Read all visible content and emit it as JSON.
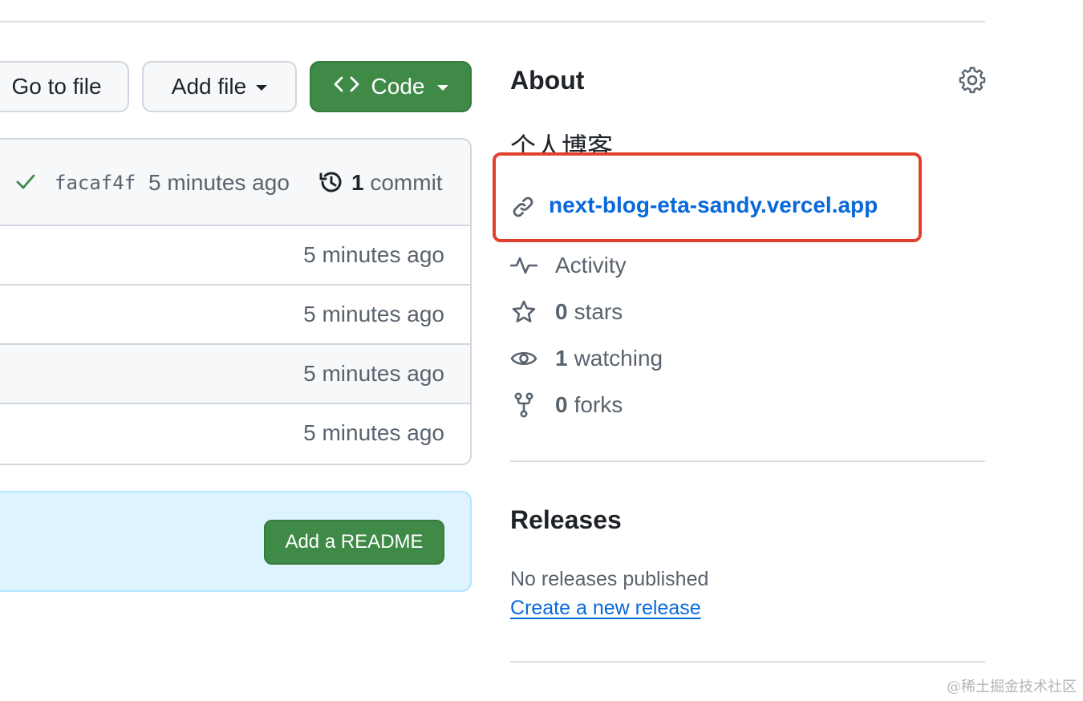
{
  "buttons": {
    "goto_label": "Go to file",
    "addfile_label": "Add file",
    "code_label": "Code"
  },
  "commit": {
    "sha": "facaf4f",
    "time": "5 minutes ago",
    "count": "1",
    "count_label": "commit"
  },
  "file_rows": [
    {
      "time": "5 minutes ago"
    },
    {
      "time": "5 minutes ago"
    },
    {
      "time": "5 minutes ago"
    },
    {
      "time": "5 minutes ago"
    }
  ],
  "readme": {
    "button_label": "Add a README"
  },
  "about": {
    "title": "About",
    "description": "个人博客",
    "website": "next-blog-eta-sandy.vercel.app",
    "activity_label": "Activity",
    "stars_count": "0",
    "stars_label": "stars",
    "watching_count": "1",
    "watching_label": "watching",
    "forks_count": "0",
    "forks_label": "forks"
  },
  "releases": {
    "title": "Releases",
    "empty_text": "No releases published",
    "create_link": "Create a new release"
  },
  "watermark": "@稀土掘金技术社区",
  "colors": {
    "primary_green": "#3f8a47",
    "link_blue": "#0969da",
    "highlight_red": "#e0412f",
    "readme_bg": "#ddf4ff"
  },
  "icons": [
    "check-icon",
    "history-icon",
    "gear-icon",
    "link-icon",
    "pulse-icon",
    "star-icon",
    "eye-icon",
    "fork-icon",
    "code-icon",
    "caret-down-icon"
  ]
}
